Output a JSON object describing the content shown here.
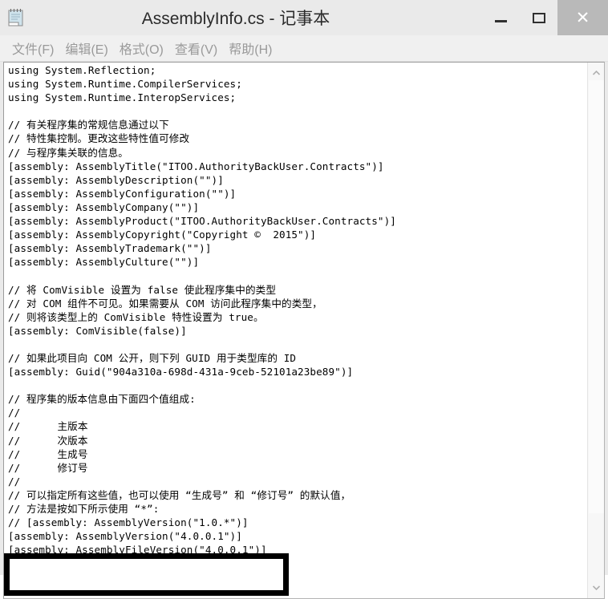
{
  "window": {
    "title": "AssemblyInfo.cs - 记事本",
    "icon": "notepad-icon",
    "buttons": {
      "minimize": "—",
      "maximize": "▢",
      "close": "✕"
    }
  },
  "menubar": {
    "items": [
      {
        "label": "文件(F)"
      },
      {
        "label": "编辑(E)"
      },
      {
        "label": "格式(O)"
      },
      {
        "label": "查看(V)"
      },
      {
        "label": "帮助(H)"
      }
    ]
  },
  "editor": {
    "lines": [
      "using System.Reflection;",
      "using System.Runtime.CompilerServices;",
      "using System.Runtime.InteropServices;",
      "",
      "// 有关程序集的常规信息通过以下",
      "// 特性集控制。更改这些特性值可修改",
      "// 与程序集关联的信息。",
      "[assembly: AssemblyTitle(\"ITOO.AuthorityBackUser.Contracts\")]",
      "[assembly: AssemblyDescription(\"\")]",
      "[assembly: AssemblyConfiguration(\"\")]",
      "[assembly: AssemblyCompany(\"\")]",
      "[assembly: AssemblyProduct(\"ITOO.AuthorityBackUser.Contracts\")]",
      "[assembly: AssemblyCopyright(\"Copyright ©  2015\")]",
      "[assembly: AssemblyTrademark(\"\")]",
      "[assembly: AssemblyCulture(\"\")]",
      "",
      "// 将 ComVisible 设置为 false 使此程序集中的类型",
      "// 对 COM 组件不可见。如果需要从 COM 访问此程序集中的类型，",
      "// 则将该类型上的 ComVisible 特性设置为 true。",
      "[assembly: ComVisible(false)]",
      "",
      "// 如果此项目向 COM 公开，则下列 GUID 用于类型库的 ID",
      "[assembly: Guid(\"904a310a-698d-431a-9ceb-52101a23be89\")]",
      "",
      "// 程序集的版本信息由下面四个值组成:",
      "//",
      "//      主版本",
      "//      次版本",
      "//      生成号",
      "//      修订号",
      "//",
      "// 可以指定所有这些值，也可以使用 “生成号” 和 “修订号” 的默认值，",
      "// 方法是按如下所示使用 “*”:",
      "// [assembly: AssemblyVersion(\"1.0.*\")]",
      "[assembly: AssemblyVersion(\"4.0.0.1\")]",
      "[assembly: AssemblyFileVersion(\"4.0.0.1\")]"
    ]
  },
  "scrollbar": {
    "up_arrow": "︿",
    "down_arrow": "﹀"
  },
  "annotation": {
    "highlighted_lines": [
      "[assembly: AssemblyVersion(\"4.0.0.1\")]",
      "[assembly: AssemblyFileVersion(\"4.0.0.1\")]"
    ],
    "color": "#000000"
  }
}
